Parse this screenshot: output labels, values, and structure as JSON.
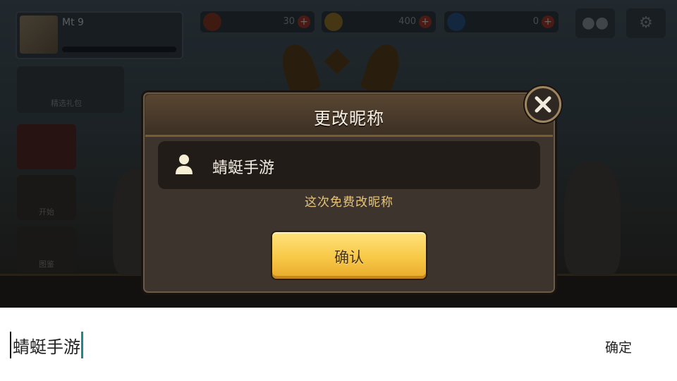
{
  "game": {
    "player_name": "Mt 9",
    "resources": [
      {
        "icon": "ore-icon",
        "value": "30"
      },
      {
        "icon": "gold-coin-icon",
        "value": "400"
      },
      {
        "icon": "diamond-icon",
        "value": "0"
      }
    ],
    "side_buttons": [
      "",
      "开始",
      "图鉴"
    ],
    "event_label": "精选礼包"
  },
  "dialog": {
    "title": "更改昵称",
    "name_value": "蜻蜓手游",
    "note": "这次免费改昵称",
    "confirm_label": "确认"
  },
  "ime": {
    "text": "蜻蜓手游",
    "confirm_label": "确定"
  },
  "colors": {
    "accent_gold": "#f8c846",
    "note_text": "#e9c57a",
    "caret": "#1d8a8a"
  }
}
